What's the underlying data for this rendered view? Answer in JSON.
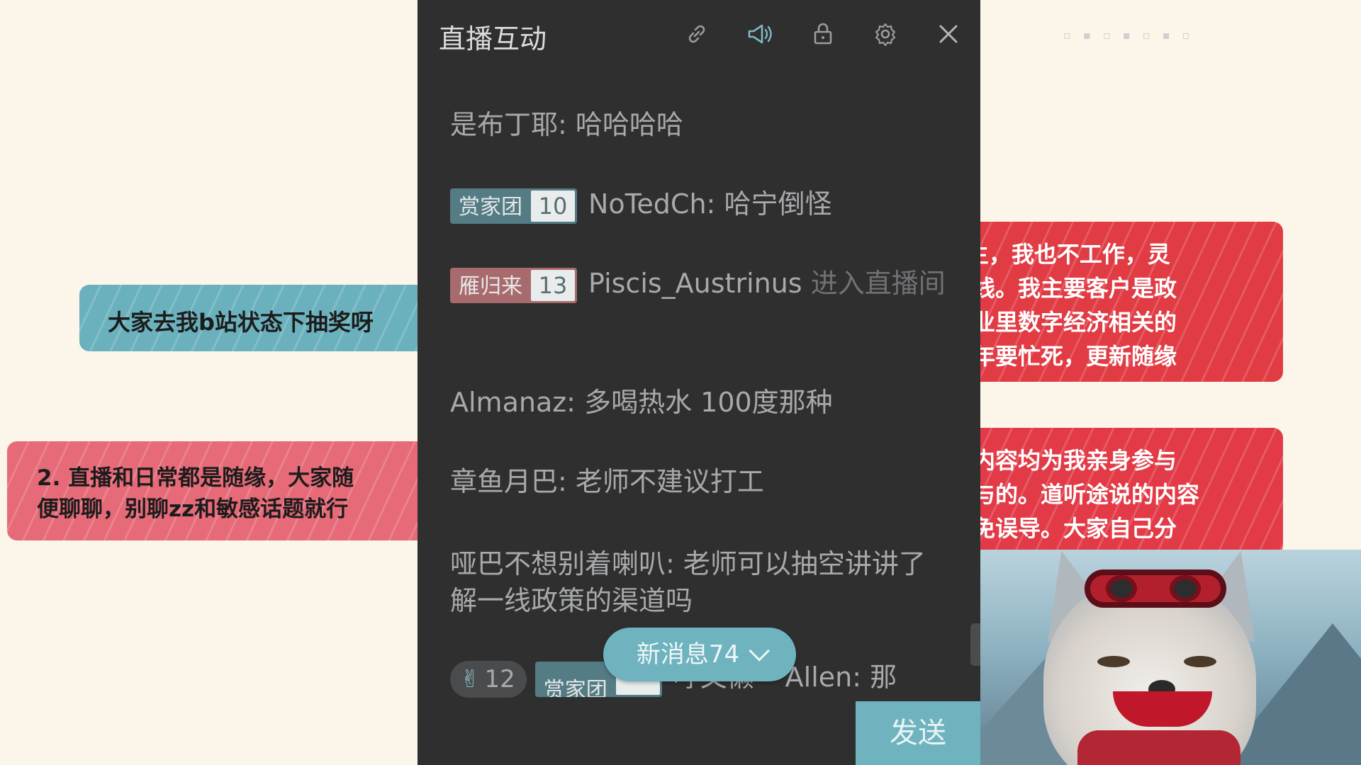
{
  "chat": {
    "title": "直播互动",
    "messages": [
      {
        "user": "是布丁耶",
        "sep": ": ",
        "text": "哈哈哈哈"
      },
      {
        "badge": {
          "name": "赏家团",
          "level": "10"
        },
        "user": "NoTedCh",
        "sep": ": ",
        "text": "哈宁倒怪"
      },
      {
        "badge": {
          "name": "雁归来",
          "level": "13"
        },
        "user": "Piscis_Austrinus",
        "text": " 进入直播间"
      },
      {
        "user": "Almanaz",
        "sep": ": ",
        "text": "多喝热水 100度那种"
      },
      {
        "user": "章鱼月巴",
        "sep": ": ",
        "text": "老师不建议打工"
      },
      {
        "user": "哑巴不想别着喇叭",
        "sep": ": ",
        "text": "老师可以抽空讲讲了解一线政策的渠道吗"
      },
      {
        "likes": "12",
        "badge": {
          "name": "赏家团",
          "level": ""
        },
        "user": "哼又懒^ Allen",
        "sep": ": ",
        "text": "那"
      }
    ],
    "new_messages": "新消息74",
    "send_label": "发送"
  },
  "overlay_notes": {
    "left_1": "大家去我b站状态下抽奖呀",
    "left_2_line_1": "2. 直播和日常都是随缘，大家随",
    "left_2_line_2": "便聊聊，别聊zz和敏感话题就行",
    "right_1": [
      "p主，我也不工作，灵",
      "一线。我主要客户是政",
      "企业里数字经济相关的",
      "明年要忙死，更新随缘"
    ],
    "right_2": [
      "新内容均为我亲身参与",
      "参与的。道听途说的内容",
      "以免误导。大家自己分"
    ]
  },
  "colors": {
    "panel_bg": "#2f2f30",
    "accent_teal": "#6fb3bf",
    "badge_teal": "#537c85",
    "badge_rose": "#a86b6d",
    "note_red": "#e13b44",
    "note_teal": "#6bb1bd",
    "note_pink": "#e66a78"
  },
  "icons": {
    "link": "link-icon",
    "announce": "announce-icon",
    "lock": "lock-icon",
    "settings": "gear-icon",
    "close": "close-icon",
    "like": "like-hand-icon",
    "expand": "chevron-down-icon"
  }
}
